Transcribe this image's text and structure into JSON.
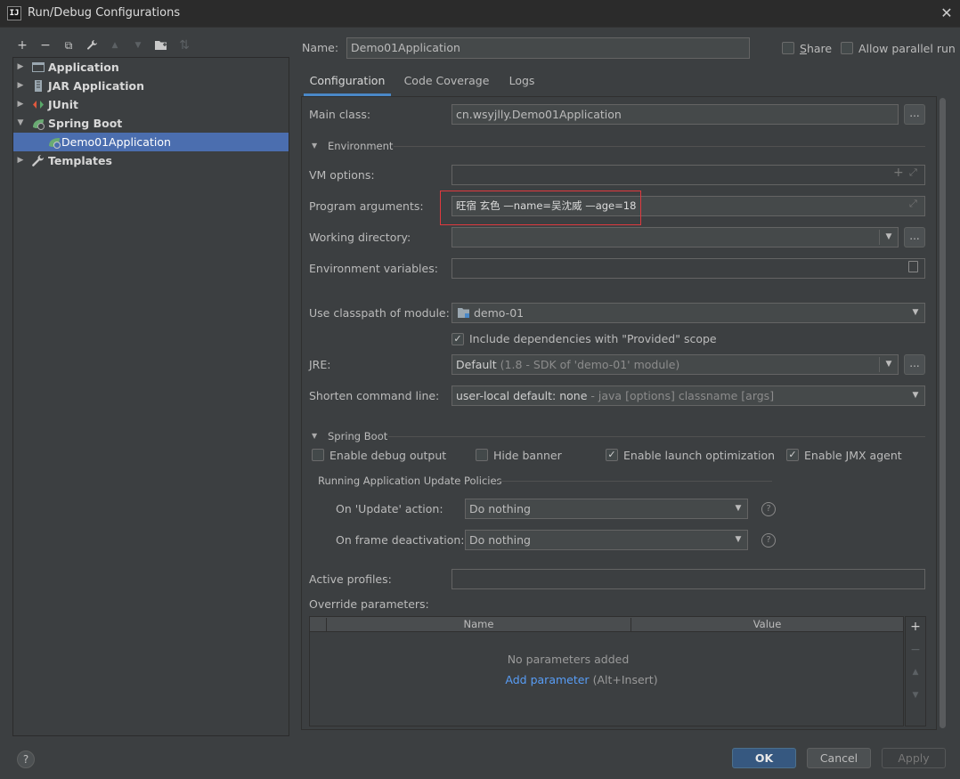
{
  "window": {
    "title": "Run/Debug Configurations",
    "icon_text": "IJ"
  },
  "toolbar": {
    "items": [
      "add-icon",
      "remove-icon",
      "copy-icon",
      "wrench-icon",
      "move-up-icon",
      "move-down-icon",
      "folder-icon",
      "sort-icon"
    ],
    "add": "+",
    "remove": "−",
    "copy": "⧉",
    "edit": "🔧",
    "up": "▲",
    "down": "▼",
    "folder": "▰",
    "sort": "⇅"
  },
  "tree": {
    "items": [
      {
        "label": "Application",
        "expanded": false
      },
      {
        "label": "JAR Application",
        "expanded": false
      },
      {
        "label": "JUnit",
        "expanded": false
      },
      {
        "label": "Spring Boot",
        "expanded": true
      },
      {
        "label": "Demo01Application",
        "selected": true
      },
      {
        "label": "Templates",
        "expanded": false
      }
    ]
  },
  "header": {
    "name_label": "Name:",
    "name_value": "Demo01Application",
    "share_label": "Share",
    "parallel_label": "Allow parallel run"
  },
  "tabs": [
    {
      "label": "Configuration",
      "active": true
    },
    {
      "label": "Code Coverage",
      "active": false
    },
    {
      "label": "Logs",
      "active": false
    }
  ],
  "config": {
    "main_class_label": "Main class:",
    "main_class_value": "cn.wsyjlly.Demo01Application",
    "dots": "...",
    "environment_title": "Environment",
    "vm_options_label": "VM options:",
    "vm_options_value": "",
    "program_args_label": "Program arguments:",
    "program_args_value": "旺宿 玄色 —name=吴沈威 —age=18",
    "working_dir_label": "Working directory:",
    "working_dir_value": "",
    "env_vars_label": "Environment variables:",
    "env_vars_value": "",
    "classpath_label": "Use classpath of module:",
    "classpath_value": "demo-01",
    "include_deps_label": "Include dependencies with \"Provided\" scope",
    "include_deps_checked": true,
    "jre_label": "JRE:",
    "jre_value_main": "Default",
    "jre_value_detail": "(1.8 - SDK of 'demo-01' module)",
    "shorten_label": "Shorten command line:",
    "shorten_value_main": "user-local default: none",
    "shorten_value_detail": "- java [options] classname [args]"
  },
  "spring_boot": {
    "title": "Spring Boot",
    "debug_output_label": "Enable debug output",
    "debug_output_checked": false,
    "hide_banner_label": "Hide banner",
    "hide_banner_checked": false,
    "launch_opt_label": "Enable launch optimization",
    "launch_opt_checked": true,
    "jmx_label": "Enable JMX agent",
    "jmx_checked": true,
    "policies_title": "Running Application Update Policies",
    "on_update_label": "On 'Update' action:",
    "on_update_value": "Do nothing",
    "on_frame_label": "On frame deactivation:",
    "on_frame_value": "Do nothing",
    "help": "?",
    "active_profiles_label": "Active profiles:",
    "active_profiles_value": "",
    "override_label": "Override parameters:",
    "columns": [
      "Name",
      "Value"
    ],
    "empty_text": "No parameters added",
    "add_link": "Add parameter",
    "add_shortcut": "(Alt+Insert)"
  },
  "footer": {
    "help": "?",
    "ok": "OK",
    "cancel": "Cancel",
    "apply": "Apply"
  },
  "colors": {
    "background": "#3c3f41",
    "selection": "#4b6eaf",
    "accent": "#4a88c7",
    "highlight_box": "#e0393e",
    "link": "#589df6"
  }
}
